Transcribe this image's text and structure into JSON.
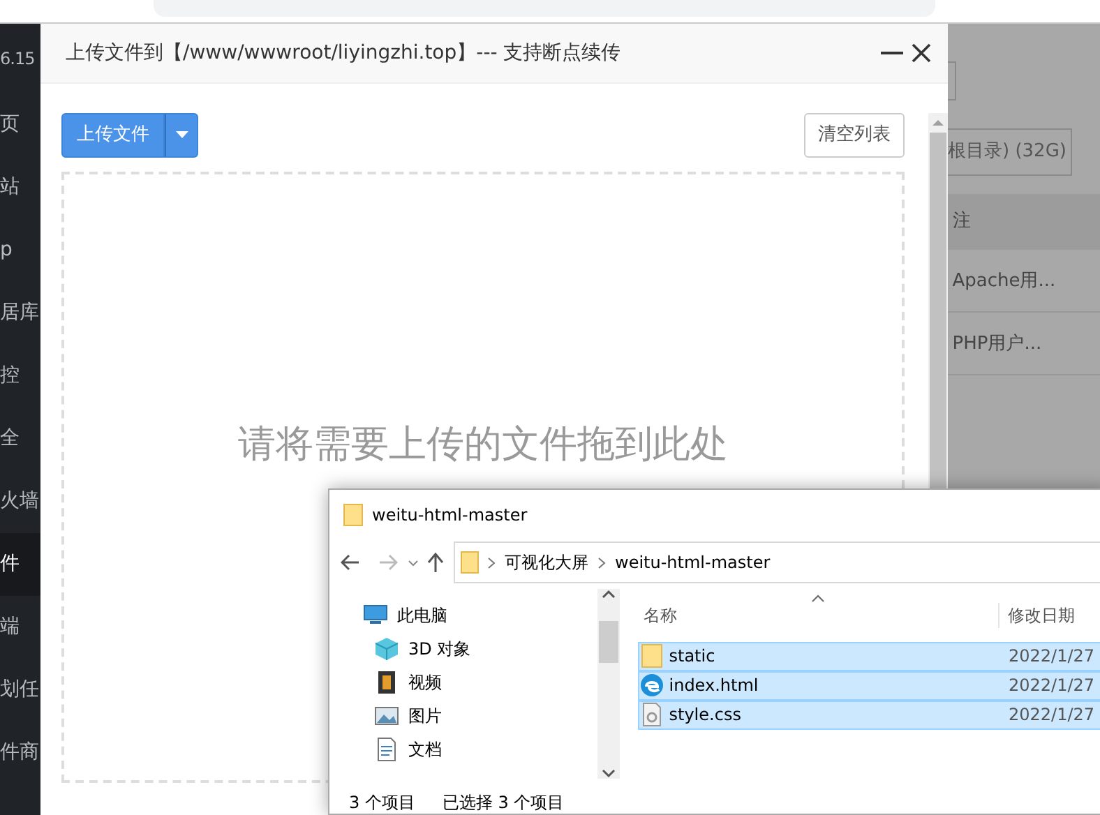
{
  "sidebar": {
    "server": "6.15",
    "items": [
      {
        "label": "页",
        "selected": false
      },
      {
        "label": "站",
        "selected": false
      },
      {
        "label": "p",
        "selected": false
      },
      {
        "label": "居库",
        "selected": false
      },
      {
        "label": "控",
        "selected": false
      },
      {
        "label": "全",
        "selected": false
      },
      {
        "label": "火墙",
        "selected": false
      },
      {
        "label": "件",
        "selected": true
      },
      {
        "label": "端",
        "selected": false
      },
      {
        "label": "划任",
        "selected": false
      },
      {
        "label": "件商",
        "selected": false
      }
    ]
  },
  "background_page": {
    "disk_button": "根目录) (32G)",
    "column_header": "注",
    "rows": [
      "Apache用...",
      "PHP用户..."
    ]
  },
  "upload_dialog": {
    "title": "上传文件到【/www/wwwroot/liyingzhi.top】--- 支持断点续传",
    "upload_button": "上传文件",
    "clear_button": "清空列表",
    "drop_hint": "请将需要上传的文件拖到此处"
  },
  "explorer": {
    "title": "weitu-html-master",
    "path": [
      "可视化大屏",
      "weitu-html-master"
    ],
    "nav_tree": [
      {
        "label": "此电脑",
        "kind": "computer"
      },
      {
        "label": "3D 对象",
        "kind": "cube"
      },
      {
        "label": "视频",
        "kind": "video"
      },
      {
        "label": "图片",
        "kind": "picture"
      },
      {
        "label": "文档",
        "kind": "document"
      }
    ],
    "columns": [
      "名称",
      "修改日期"
    ],
    "files": [
      {
        "name": "static",
        "date": "2022/1/27",
        "kind": "folder",
        "selected": true
      },
      {
        "name": "index.html",
        "date": "2022/1/27",
        "kind": "edge",
        "selected": true
      },
      {
        "name": "style.css",
        "date": "2022/1/27",
        "kind": "css",
        "selected": true
      }
    ],
    "status": {
      "count": "3 个项目",
      "selection": "已选择 3 个项目"
    }
  }
}
